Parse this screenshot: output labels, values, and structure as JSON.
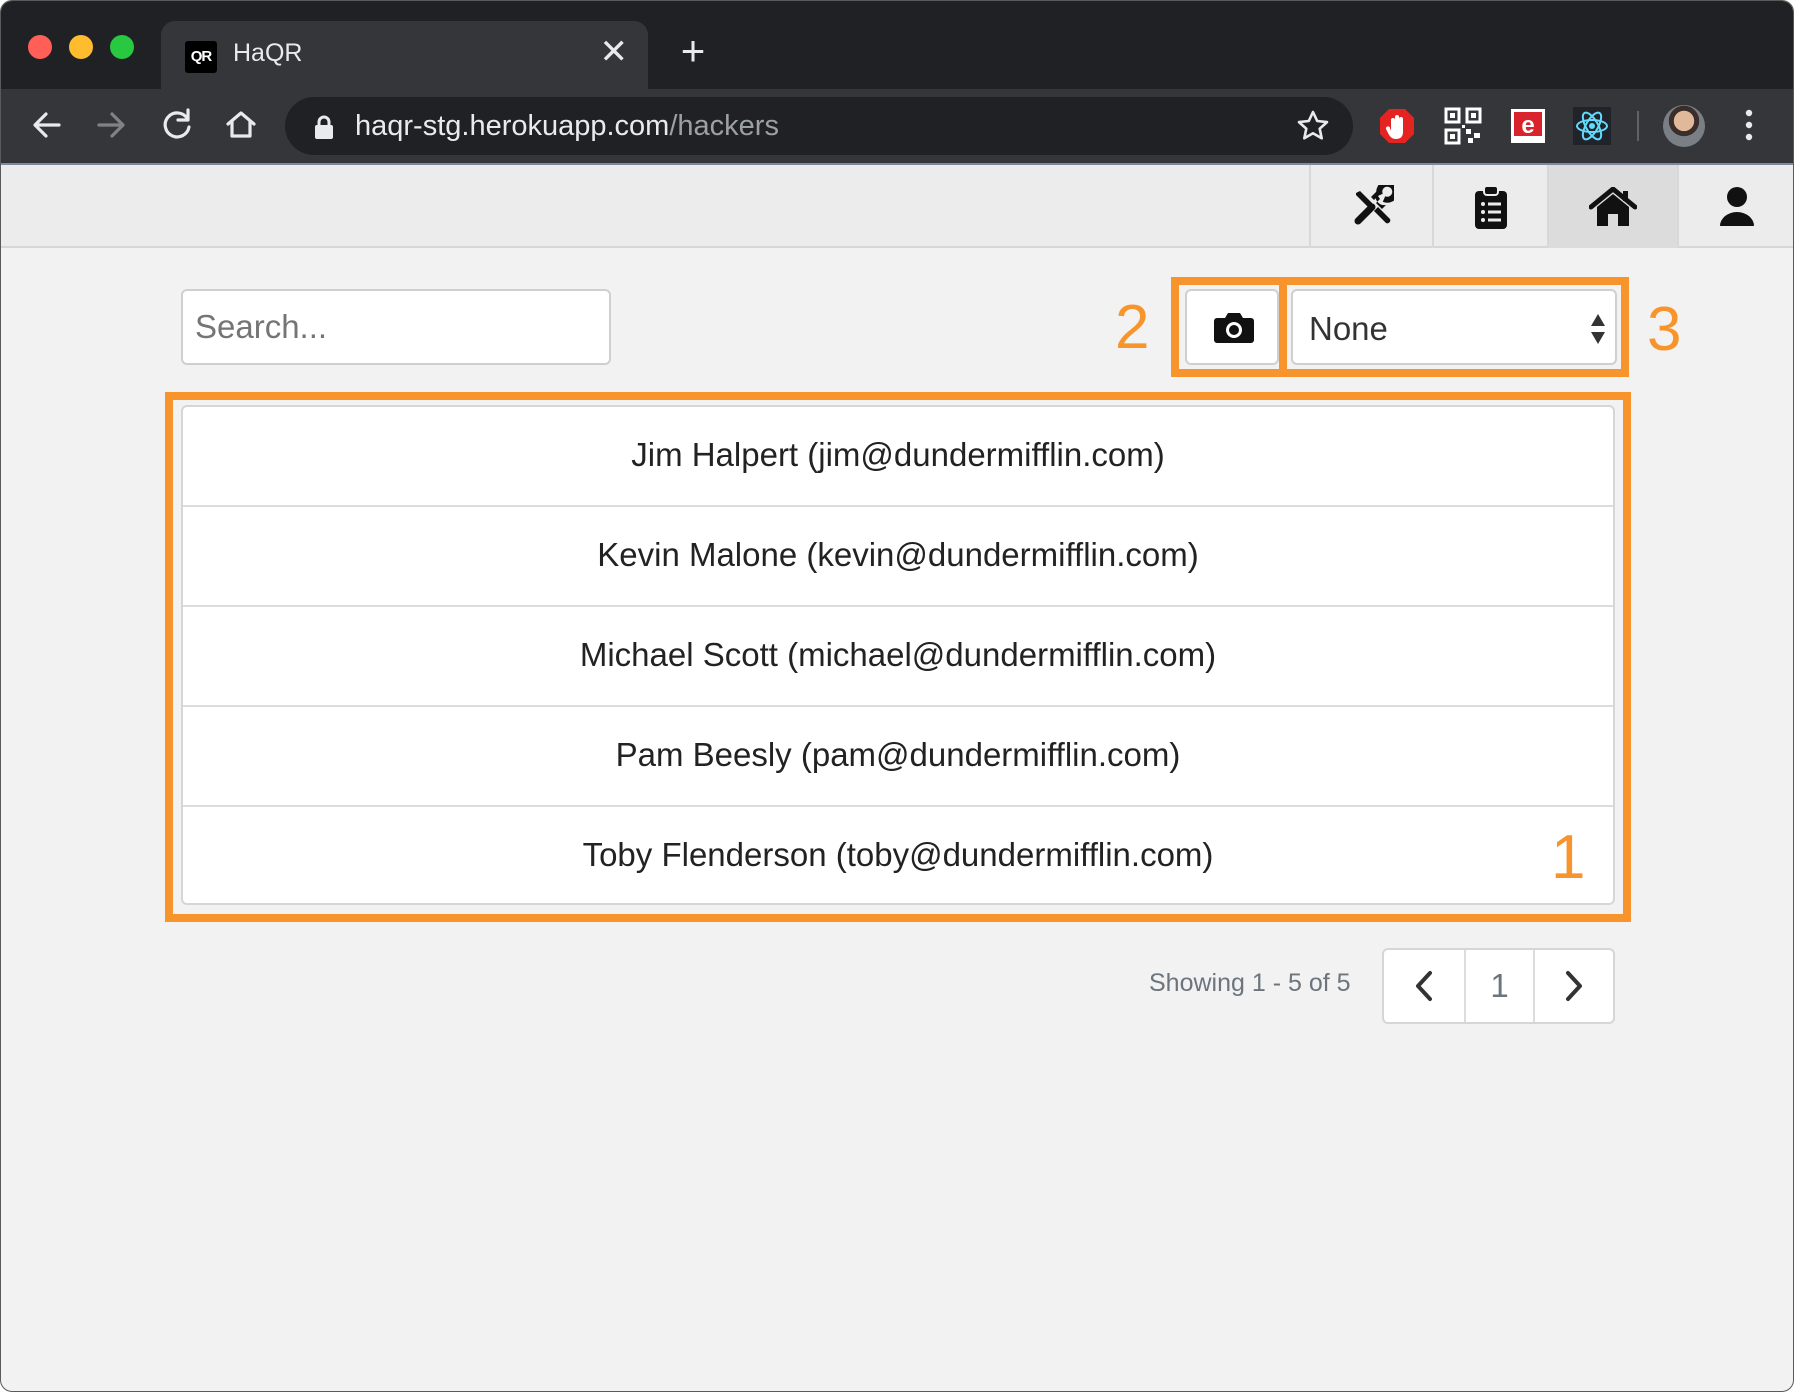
{
  "browser": {
    "tab_favicon": "QR",
    "tab_title": "HaQR",
    "tab_close": "✕",
    "new_tab": "+",
    "url_host": "haqr-stg.herokuapp.com",
    "url_path": "/hackers",
    "icons": {
      "back": "back-arrow-icon",
      "forward": "forward-arrow-icon",
      "reload": "reload-icon",
      "home": "home-icon",
      "lock": "lock-icon",
      "bookmark": "star-icon",
      "extensions": [
        "hand-stop-icon",
        "qr-code-icon",
        "e-extension-icon",
        "react-devtools-icon"
      ],
      "menu": "kebab-menu-icon"
    }
  },
  "navbar": {
    "items": [
      {
        "icon": "tools-icon",
        "active": false
      },
      {
        "icon": "clipboard-list-icon",
        "active": false
      },
      {
        "icon": "home-icon",
        "active": true
      },
      {
        "icon": "user-icon",
        "active": false
      }
    ]
  },
  "search": {
    "placeholder": "Search..."
  },
  "scanner": {
    "icon": "camera-icon",
    "select_value": "None"
  },
  "annotations": {
    "list": "1",
    "camera": "2",
    "select": "3",
    "color": "#f7952c"
  },
  "hackers": [
    "Jim Halpert (jim@dundermifflin.com)",
    "Kevin Malone (kevin@dundermifflin.com)",
    "Michael Scott (michael@dundermifflin.com)",
    "Pam Beesly (pam@dundermifflin.com)",
    "Toby Flenderson (toby@dundermifflin.com)"
  ],
  "pagination": {
    "summary": "Showing 1 - 5 of 5",
    "current_page": "1"
  }
}
